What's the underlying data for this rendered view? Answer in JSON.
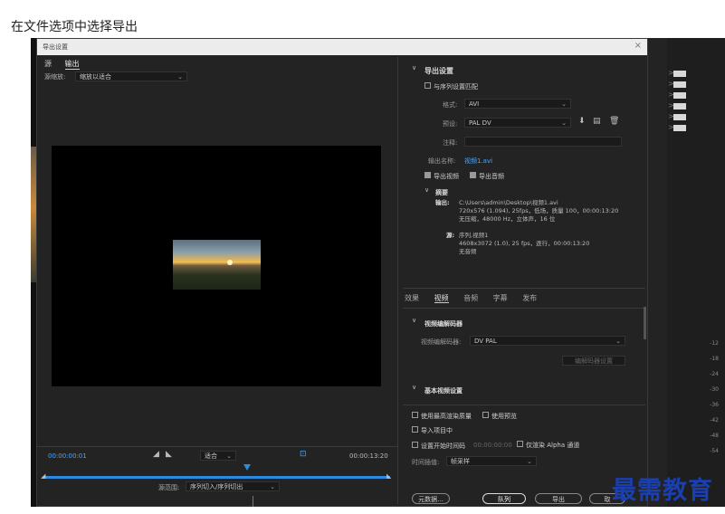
{
  "caption": "在文件选项中选择导出",
  "dialog": {
    "title": "导出设置",
    "close": "×",
    "tabs": [
      "源",
      "输出"
    ],
    "source_scaling_label": "源缩放:",
    "source_scaling_value": "缩放以适合"
  },
  "timeline": {
    "tc_start": "00:00:00:01",
    "tc_end": "00:00:13:20",
    "fit_label": "适合",
    "source_range_label": "源范围:",
    "source_range_value": "序列切入/序列切出"
  },
  "export_settings": {
    "section_title": "导出设置",
    "match_sequence": "与序列设置匹配",
    "format_label": "格式:",
    "format_value": "AVI",
    "preset_label": "预设:",
    "preset_value": "PAL DV",
    "comments_label": "注释:",
    "output_name_label": "输出名称:",
    "output_name_value": "视频1.avi",
    "export_video": "导出视频",
    "export_audio": "导出音频"
  },
  "summary": {
    "title": "摘要",
    "output_label": "输出:",
    "output_lines": [
      "C:\\Users\\admin\\Desktop\\视频1.avi",
      "720x576 (1.094), 25fps，低场，质量 100，00:00:13:20",
      "无压缩，48000 Hz，立体声，16 位"
    ],
    "source_label": "源:",
    "source_lines": [
      "序列,视频1",
      "4608x3072 (1.0), 25 fps，逐行，00:00:13:20",
      "无音频"
    ]
  },
  "settings_tabs": [
    "效果",
    "视频",
    "音频",
    "字幕",
    "发布"
  ],
  "video_codec": {
    "section_title": "视频编解码器",
    "codec_label": "视频编解码器:",
    "codec_value": "DV PAL",
    "codec_settings_button": "编解码器设置",
    "basic_settings_title": "基本视频设置"
  },
  "options": {
    "max_render_quality": "使用最高渲染质量",
    "use_previews": "使用预览",
    "import_to_project": "导入项目中",
    "set_start_timecode": "设置开始时间码",
    "start_timecode_value": "00:00:00:00",
    "render_alpha_only": "仅渲染 Alpha 通道",
    "time_interp_label": "时间插值:",
    "time_interp_value": "帧采样"
  },
  "buttons": {
    "metadata": "元数据...",
    "queue": "队列",
    "export": "导出",
    "cancel": "取"
  },
  "meter_ticks": [
    "-12",
    "-18",
    "-24",
    "-30",
    "-36",
    "-42",
    "-48",
    "-54"
  ],
  "watermark": "最需教育"
}
